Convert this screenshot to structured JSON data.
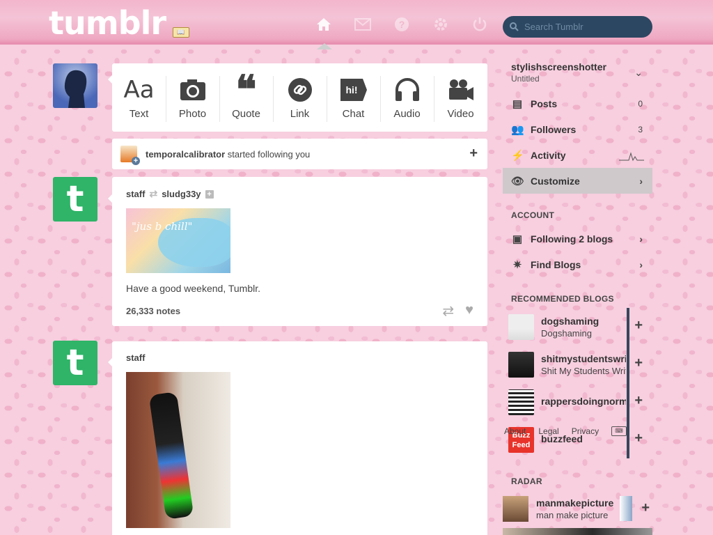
{
  "brand": {
    "logo": "tumblr",
    "badge": "📖"
  },
  "header": {
    "search_placeholder": "Search Tumblr",
    "nav": [
      "home-icon",
      "mail-icon",
      "help-icon",
      "settings-icon",
      "power-icon"
    ]
  },
  "composer": {
    "items": [
      {
        "glyph": "Aa",
        "label": "Text"
      },
      {
        "glyph": "photo",
        "label": "Photo"
      },
      {
        "glyph": "❝",
        "label": "Quote"
      },
      {
        "glyph": "link",
        "label": "Link"
      },
      {
        "glyph": "hi!",
        "label": "Chat"
      },
      {
        "glyph": "audio",
        "label": "Audio"
      },
      {
        "glyph": "video",
        "label": "Video"
      }
    ]
  },
  "notification": {
    "user": "temporalcalibrator",
    "text": " started following you",
    "action": "+"
  },
  "posts": [
    {
      "author": "staff",
      "reblogged_from": "sludg33y",
      "image_caption": "\"jus b chill\"",
      "body": "Have a good weekend, Tumblr.",
      "notes": "26,333 notes"
    },
    {
      "author": "staff"
    }
  ],
  "sidebar": {
    "blog_name": "stylishscreenshotter",
    "blog_title": "Untitled",
    "menu": [
      {
        "label": "Posts",
        "count": "0"
      },
      {
        "label": "Followers",
        "count": "3"
      },
      {
        "label": "Activity"
      },
      {
        "label": "Customize"
      }
    ],
    "account_heading": "ACCOUNT",
    "account": [
      {
        "label": "Following 2 blogs"
      },
      {
        "label": "Find Blogs"
      }
    ],
    "recommended_heading": "RECOMMENDED BLOGS",
    "recommended": [
      {
        "name": "dogshaming",
        "title": "Dogshaming"
      },
      {
        "name": "shitmystudentswrite",
        "title": "Shit My Students Write"
      },
      {
        "name": "rappersdoingnormalshit",
        "title": ""
      },
      {
        "name": "buzzfeed",
        "title": ""
      }
    ],
    "footer": [
      "About",
      "Legal",
      "Privacy"
    ],
    "radar_heading": "RADAR",
    "radar": {
      "name": "manmakepicture",
      "title": "man make picture"
    }
  }
}
